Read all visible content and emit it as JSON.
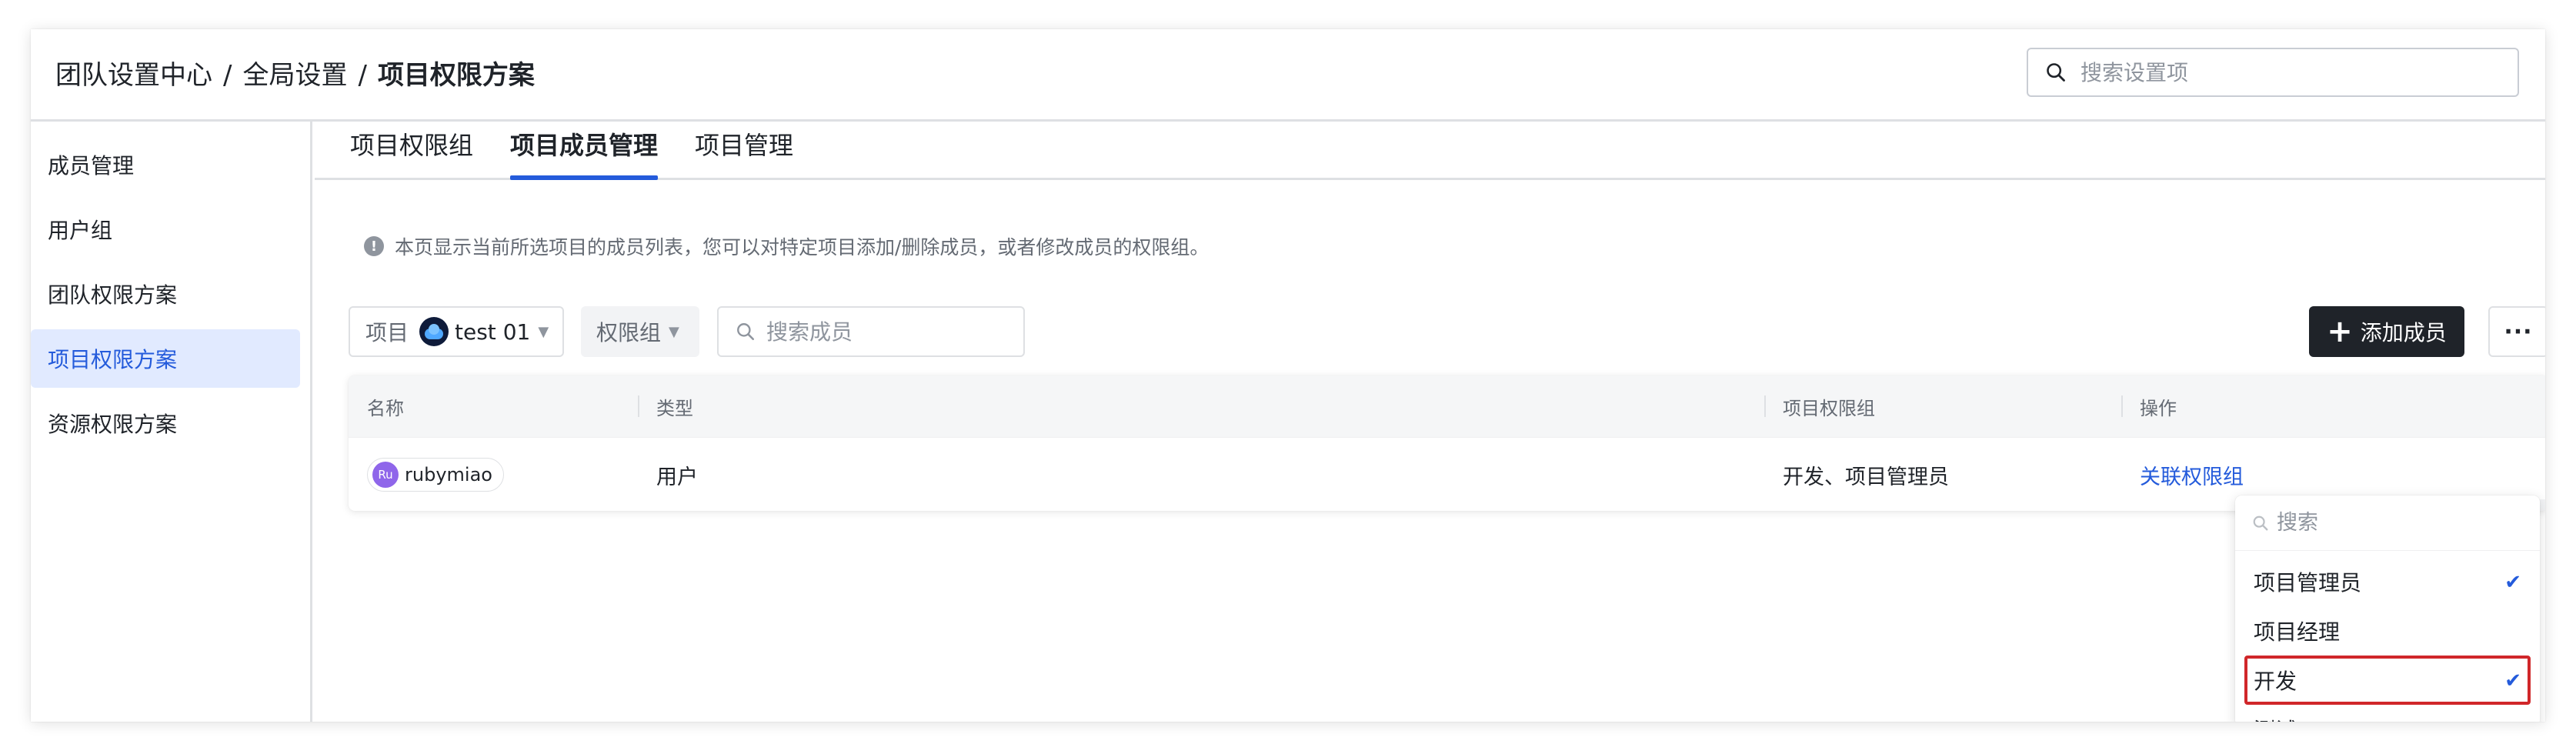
{
  "breadcrumb": {
    "items": [
      "团队设置中心",
      "全局设置"
    ],
    "separator": "/",
    "current": "项目权限方案"
  },
  "header_search": {
    "placeholder": "搜索设置项",
    "icon": "search-icon"
  },
  "sidebar": {
    "items": [
      {
        "label": "成员管理",
        "active": false
      },
      {
        "label": "用户组",
        "active": false
      },
      {
        "label": "团队权限方案",
        "active": false
      },
      {
        "label": "项目权限方案",
        "active": true
      },
      {
        "label": "资源权限方案",
        "active": false
      }
    ]
  },
  "tabs": [
    {
      "label": "项目权限组",
      "active": false
    },
    {
      "label": "项目成员管理",
      "active": true
    },
    {
      "label": "项目管理",
      "active": false
    }
  ],
  "notice": {
    "icon": "info-icon",
    "text": "本页显示当前所选项目的成员列表，您可以对特定项目添加/删除成员，或者修改成员的权限组。"
  },
  "filters": {
    "project_label": "项目",
    "project_value": "test 01",
    "group_label": "权限组",
    "member_search_placeholder": "搜索成员"
  },
  "actions": {
    "add_member": "添加成员",
    "more": "···"
  },
  "table": {
    "columns": [
      "名称",
      "类型",
      "项目权限组",
      "操作"
    ],
    "rows": [
      {
        "avatar": "Ru",
        "name": "rubymiao",
        "type": "用户",
        "groups": "开发、项目管理员",
        "action": "关联权限组"
      }
    ]
  },
  "dropdown": {
    "search_placeholder": "搜索",
    "options": [
      {
        "label": "项目管理员",
        "checked": true
      },
      {
        "label": "项目经理",
        "checked": false
      },
      {
        "label": "开发",
        "checked": true,
        "highlighted": true
      },
      {
        "label": "测试",
        "checked": false
      }
    ]
  },
  "colors": {
    "accent": "#245bdb",
    "active_bg": "#e1eaff",
    "primary_button": "#1f2329",
    "highlight_border": "#d0272a",
    "avatar": "#8f66ea"
  }
}
